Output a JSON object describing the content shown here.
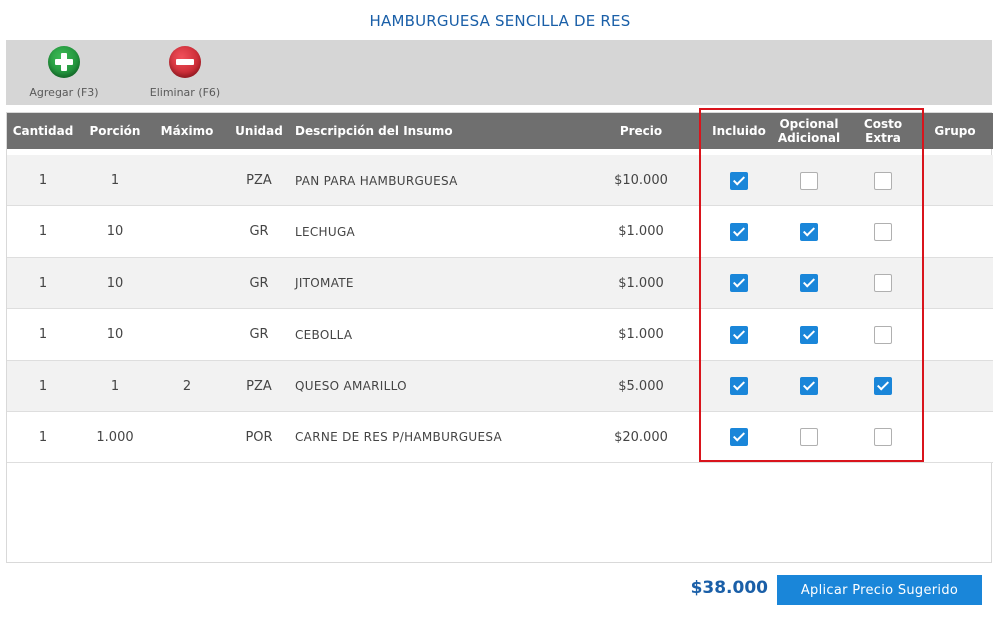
{
  "title": "HAMBURGUESA SENCILLA DE RES",
  "toolbar": {
    "add_label": "Agregar (F3)",
    "delete_label": "Eliminar (F6)",
    "add_icon": "plus-circle-icon",
    "delete_icon": "minus-circle-icon"
  },
  "table": {
    "headers": {
      "cantidad": "Cantidad",
      "porcion": "Porción",
      "maximo": "Máximo",
      "unidad": "Unidad",
      "descripcion": "Descripción del Insumo",
      "precio": "Precio",
      "incluido": "Incluido",
      "opcional_1": "Opcional",
      "opcional_2": "Adicional",
      "costo_1": "Costo",
      "costo_2": "Extra",
      "grupo": "Grupo"
    },
    "rows": [
      {
        "cantidad": "1",
        "porcion": "1",
        "maximo": "",
        "unidad": "PZA",
        "descripcion": "PAN PARA HAMBURGUESA",
        "precio": "$10.000",
        "incluido": true,
        "opcional": false,
        "costo_extra": false,
        "grupo": ""
      },
      {
        "cantidad": "1",
        "porcion": "10",
        "maximo": "",
        "unidad": "GR",
        "descripcion": "LECHUGA",
        "precio": "$1.000",
        "incluido": true,
        "opcional": true,
        "costo_extra": false,
        "grupo": ""
      },
      {
        "cantidad": "1",
        "porcion": "10",
        "maximo": "",
        "unidad": "GR",
        "descripcion": "JITOMATE",
        "precio": "$1.000",
        "incluido": true,
        "opcional": true,
        "costo_extra": false,
        "grupo": ""
      },
      {
        "cantidad": "1",
        "porcion": "10",
        "maximo": "",
        "unidad": "GR",
        "descripcion": "CEBOLLA",
        "precio": "$1.000",
        "incluido": true,
        "opcional": true,
        "costo_extra": false,
        "grupo": ""
      },
      {
        "cantidad": "1",
        "porcion": "1",
        "maximo": "2",
        "unidad": "PZA",
        "descripcion": "QUESO AMARILLO",
        "precio": "$5.000",
        "incluido": true,
        "opcional": true,
        "costo_extra": true,
        "grupo": ""
      },
      {
        "cantidad": "1",
        "porcion": "1.000",
        "maximo": "",
        "unidad": "POR",
        "descripcion": "CARNE DE RES P/HAMBURGUESA",
        "precio": "$20.000",
        "incluido": true,
        "opcional": false,
        "costo_extra": false,
        "grupo": ""
      }
    ]
  },
  "footer": {
    "total": "$38.000",
    "apply_label": "Aplicar Precio Sugerido"
  },
  "colors": {
    "accent": "#1a86d9",
    "title": "#1a5fa8",
    "header_bg": "#6f6f6f",
    "highlight": "#d9141c"
  }
}
